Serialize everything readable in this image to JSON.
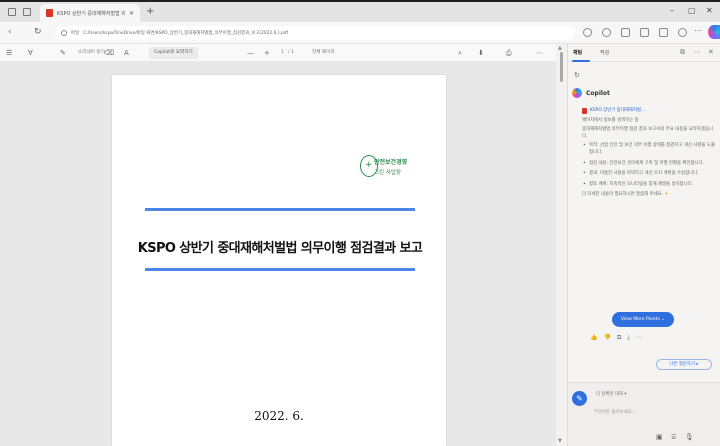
{
  "tab": {
    "title": "KSPO 상반기 중대재해처벌법 의...",
    "close_glyph": "✕",
    "newtab_glyph": "+"
  },
  "window_controls": {
    "minimize": "–",
    "maximize": "▢",
    "close": "✕"
  },
  "address_bar": {
    "nav_back": "‹",
    "nav_refresh": "↻",
    "prefix": "파일",
    "url": "C:/Users/kspo/OneDrive/바탕 화면/KSPO_상반기_중대재해처벌법_의무이행_점검결과_보고(2022.6.).pdf"
  },
  "pdf_toolbar": {
    "contents_glyph": "☰",
    "draw_glyph": "✎",
    "highlight_glyph": "∀",
    "erase_glyph": "⌫",
    "text_glyph": "A",
    "read_label": "소리내어 읽기",
    "copilot_summarize": "Copilot로 요약하기",
    "zoom_out": "—",
    "zoom_in": "+",
    "page_current": "1",
    "page_total": "/ 1",
    "fit_label": "전체 페이지",
    "search_glyph": "⌕",
    "save_glyph": "⬇",
    "print_glyph": "⎙",
    "more_glyph": "⋯"
  },
  "document": {
    "seal_line1": "안전보건경영",
    "seal_line2": "그린 사업장",
    "seal_glyph": "+",
    "title": "KSPO 상반기 중대재해처벌법 의무이행 점검결과 보고",
    "date": "2022. 6."
  },
  "scrollbar": {
    "up": "▲",
    "down": "▼"
  },
  "sidebar": {
    "tab_chat": "채팅",
    "tab_compose": "작성",
    "refresh_glyph": "↻",
    "assistant_name": "Copilot",
    "source_label": "KSPO 상반기 중대재해처벌...",
    "source_note": "페이지에서 정보를 검색하는 중",
    "intro": "중대재해처벌법 의무이행 점검 결과 보고서의 주요 내용을 요약하겠습니다.",
    "bullets": [
      "목적: 산업 안전 및 보건 의무 이행 상태를 점검하고 개선 사항을 도출합니다.",
      "점검 내용: 안전보건 관리체계 구축 및 이행 현황을 확인합니다.",
      "결과: 미흡한 사항을 파악하고 개선 조치 계획을 수립합니다.",
      "향후 계획: 지속적인 모니터링을 통해 재발을 방지합니다."
    ],
    "outro": "더 자세한 내용이 필요하시면 말씀해 주세요.",
    "sparkle": "✦",
    "show_more": "View More Points ⌄",
    "feedback": [
      "👍",
      "👎",
      "⧉",
      "⤓",
      "⋯"
    ],
    "suggestion": "다른 질문하기 ▸",
    "new_topic_glyph": "✎",
    "mode_label": "더 정확한 대화 ▾",
    "input_placeholder": "무엇이든 물어보세요...",
    "dock_icons": [
      "▣",
      "⌸",
      "🎙"
    ]
  }
}
